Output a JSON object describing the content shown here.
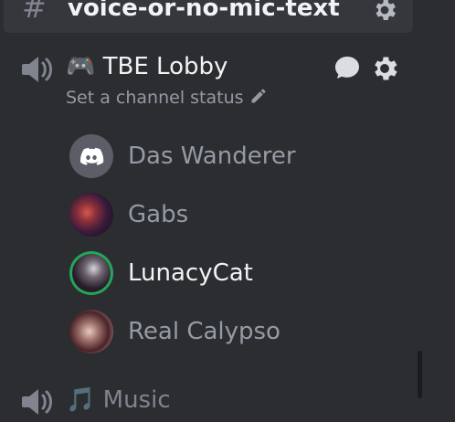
{
  "top_channel": {
    "icon": "hash-icon",
    "label": "voice-or-no-mic-text"
  },
  "voice_channel": {
    "emoji": "🎮",
    "name": "TBE Lobby",
    "status_placeholder": "Set a channel status"
  },
  "voice_users": [
    {
      "name": "Das Wanderer",
      "avatar": "discord-default",
      "speaking": false
    },
    {
      "name": "Gabs",
      "avatar": "image",
      "speaking": false
    },
    {
      "name": "LunacyCat",
      "avatar": "image",
      "speaking": true
    },
    {
      "name": "Real Calypso",
      "avatar": "image",
      "speaking": false
    }
  ],
  "bottom_channel": {
    "label": "🎵 Music"
  },
  "colors": {
    "background": "#2b2d31",
    "selected_row": "#35373c",
    "text_bright": "#f2f3f5",
    "text_muted": "#949ba4",
    "speaking_ring": "#23a55a",
    "discord_avatar_bg": "#5b5e66"
  }
}
